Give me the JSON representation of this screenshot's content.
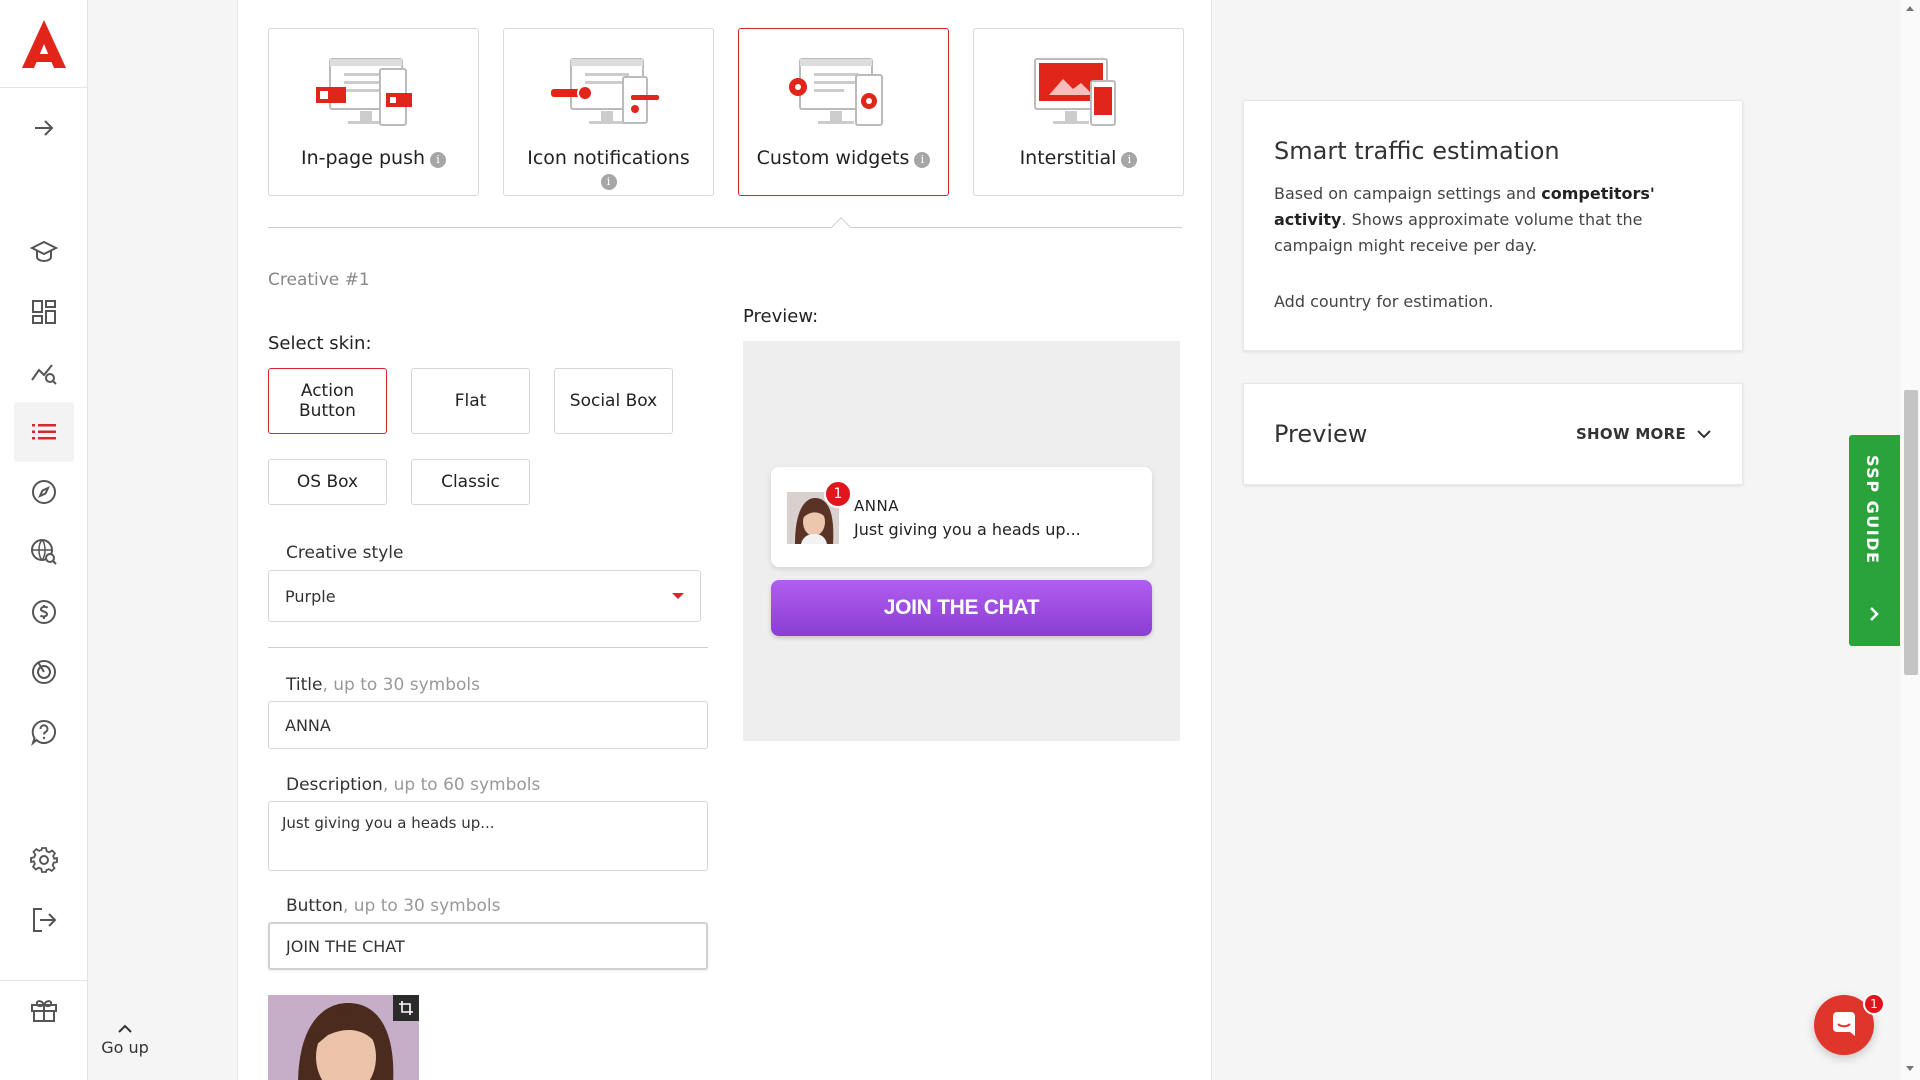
{
  "sidebar": {
    "icons": [
      "learn-icon",
      "dashboard-icon",
      "statistics-icon",
      "campaigns-icon",
      "explore-icon",
      "audience-search-icon",
      "finance-icon",
      "targeting-icon",
      "help-icon"
    ],
    "bottom_icons": [
      "settings-icon",
      "logout-icon"
    ],
    "active_index": 3
  },
  "go_up": "Go up",
  "ad_types": [
    {
      "label": "In-page push",
      "selected": false
    },
    {
      "label": "Icon notifications",
      "selected": false
    },
    {
      "label": "Custom widgets",
      "selected": true
    },
    {
      "label": "Interstitial",
      "selected": false
    }
  ],
  "creative": {
    "number_label": "Creative #1",
    "select_skin_label": "Select skin:",
    "skins": [
      "Action Button",
      "Flat",
      "Social Box",
      "OS Box",
      "Classic"
    ],
    "selected_skin": "Action Button",
    "style_label": "Creative style",
    "style_value": "Purple",
    "title_label": "Title",
    "title_hint": ", up to 30 symbols",
    "title_value": "ANNA",
    "description_label": "Description",
    "description_hint": ", up to 60 symbols",
    "description_value": "Just giving you a heads up...",
    "button_label": "Button",
    "button_hint": ", up to 30 symbols",
    "button_value": "JOIN THE CHAT"
  },
  "preview": {
    "label": "Preview:",
    "badge": "1",
    "title": "ANNA",
    "description": "Just giving you a heads up...",
    "button": "JOIN THE CHAT"
  },
  "smart_estimation": {
    "title": "Smart traffic estimation",
    "text_before": "Based on campaign settings and ",
    "text_bold": "competitors' activity",
    "text_after": ". Shows approximate volume that the campaign might receive per day.",
    "country_note": "Add country for estimation."
  },
  "preview_panel": {
    "title": "Preview",
    "show_more": "SHOW MORE"
  },
  "ssp_guide": "SSP GUIDE",
  "chat": {
    "badge": "1"
  },
  "colors": {
    "brand_red": "#d7262d",
    "join_purple": "#9b4ae0",
    "guide_green": "#2aa43a"
  }
}
